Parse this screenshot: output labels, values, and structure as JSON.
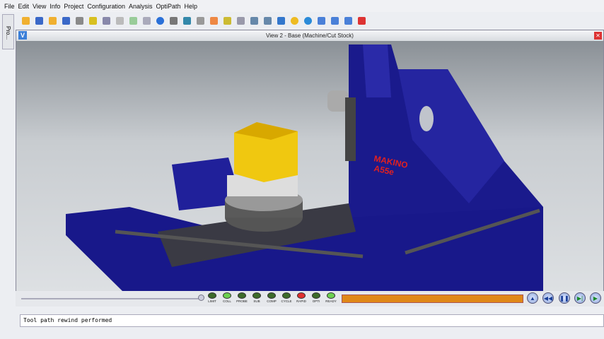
{
  "menu": [
    "File",
    "Edit",
    "View",
    "Info",
    "Project",
    "Configuration",
    "Analysis",
    "OptiPath",
    "Help"
  ],
  "left_panel": {
    "label": "Pro..."
  },
  "toolbar": [
    {
      "icon": "open-folder-icon",
      "color": "#f0b030"
    },
    {
      "icon": "save-icon",
      "color": "#3a68c8"
    },
    {
      "icon": "open-icon",
      "color": "#f0b030"
    },
    {
      "icon": "save-as-icon",
      "color": "#3a68c8"
    },
    {
      "icon": "tools-icon",
      "color": "#8a8a8a"
    },
    {
      "icon": "shield-icon",
      "color": "#d8c020"
    },
    {
      "icon": "tree-icon",
      "color": "#88a"
    },
    {
      "icon": "doc-icon",
      "color": "#bbb"
    },
    {
      "icon": "check-doc-icon",
      "color": "#9c9"
    },
    {
      "icon": "monitor-icon",
      "color": "#aab"
    },
    {
      "icon": "info-icon",
      "color": "#2a70d8"
    },
    {
      "icon": "machine-icon",
      "color": "#777"
    },
    {
      "icon": "chart-icon",
      "color": "#38a"
    },
    {
      "icon": "probe-icon",
      "color": "#999"
    },
    {
      "icon": "stock-icon",
      "color": "#e84"
    },
    {
      "icon": "fixture-icon",
      "color": "#cb3"
    },
    {
      "icon": "zoom-box-icon",
      "color": "#99a"
    },
    {
      "icon": "zoom-in-icon",
      "color": "#68a"
    },
    {
      "icon": "zoom-out-icon",
      "color": "#68a"
    },
    {
      "icon": "grid-icon",
      "color": "#37c"
    },
    {
      "icon": "sphere-icon",
      "color": "#eb2"
    },
    {
      "icon": "rotate-icon",
      "color": "#2a8ad8"
    },
    {
      "icon": "single-view-icon",
      "color": "#4a80d8"
    },
    {
      "icon": "split-vertical-icon",
      "color": "#4a80d8"
    },
    {
      "icon": "split-horizontal-icon",
      "color": "#4a80d8"
    },
    {
      "icon": "close-views-icon",
      "color": "#d33"
    }
  ],
  "view": {
    "title": "View 2 - Base (Machine/Cut Stock)",
    "logo": "V",
    "machine_label": [
      "MAKINO",
      "A55e"
    ]
  },
  "controls": {
    "leds": [
      {
        "label": "LIMIT",
        "color": "#3d6b2a"
      },
      {
        "label": "COLL",
        "color": "#6cd050"
      },
      {
        "label": "PROBE",
        "color": "#3d6b2a"
      },
      {
        "label": "SUB",
        "color": "#3d6b2a"
      },
      {
        "label": "COMP",
        "color": "#3d6b2a"
      },
      {
        "label": "CYCLE",
        "color": "#3d6b2a"
      },
      {
        "label": "RAPID",
        "color": "#e03030"
      },
      {
        "label": "OPTI",
        "color": "#3d6b2a"
      },
      {
        "label": "READY",
        "color": "#6cd050"
      }
    ],
    "progress": 1.0,
    "progress_color": "#e08818"
  },
  "status": {
    "message": "Tool path rewind performed"
  }
}
